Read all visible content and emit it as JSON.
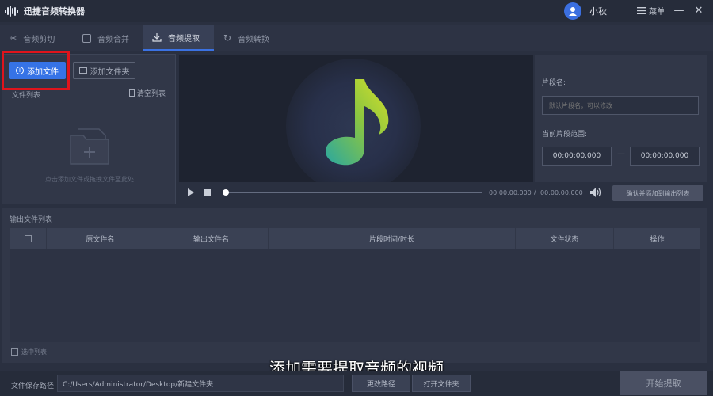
{
  "app": {
    "title": "迅捷音频转换器"
  },
  "user": {
    "name": "小秋"
  },
  "window": {
    "menu_label": "菜单",
    "minimize": "—",
    "close": "✕"
  },
  "tabs": [
    {
      "label": "音频剪切",
      "active": false
    },
    {
      "label": "音频合并",
      "active": false
    },
    {
      "label": "音频提取",
      "active": true
    },
    {
      "label": "音频转换",
      "active": false
    }
  ],
  "file_panel": {
    "add_file_label": "添加文件",
    "add_folder_label": "添加文件夹",
    "list_label": "文件列表",
    "clear_label": "清空列表",
    "empty_hint": "点击添加文件或拖拽文件至此处"
  },
  "player": {
    "current_time": "00:00:00.000",
    "separator": "/",
    "total_time": "00:00:00.000"
  },
  "settings": {
    "segment_name_label": "片段名:",
    "segment_name_placeholder": "默认片段名，可以修改",
    "range_label": "当前片段范围:",
    "range_start": "00:00:00.000",
    "range_dash": "—",
    "range_end": "00:00:00.000",
    "confirm_label": "确认并添加到输出列表"
  },
  "output": {
    "label": "输出文件列表",
    "columns": [
      "原文件名",
      "输出文件名",
      "片段时间/时长",
      "文件状态",
      "操作"
    ],
    "select_all_label": "选中列表"
  },
  "subtitle": "添加需要提取音频的视频",
  "bottom": {
    "save_label": "文件保存路径:",
    "save_path": "C:/Users/Administrator/Desktop/新建文件夹",
    "change_path_label": "更改路径",
    "open_folder_label": "打开文件夹",
    "start_label": "开始提取"
  },
  "colors": {
    "accent": "#3673e6",
    "highlight": "#e0141c"
  }
}
